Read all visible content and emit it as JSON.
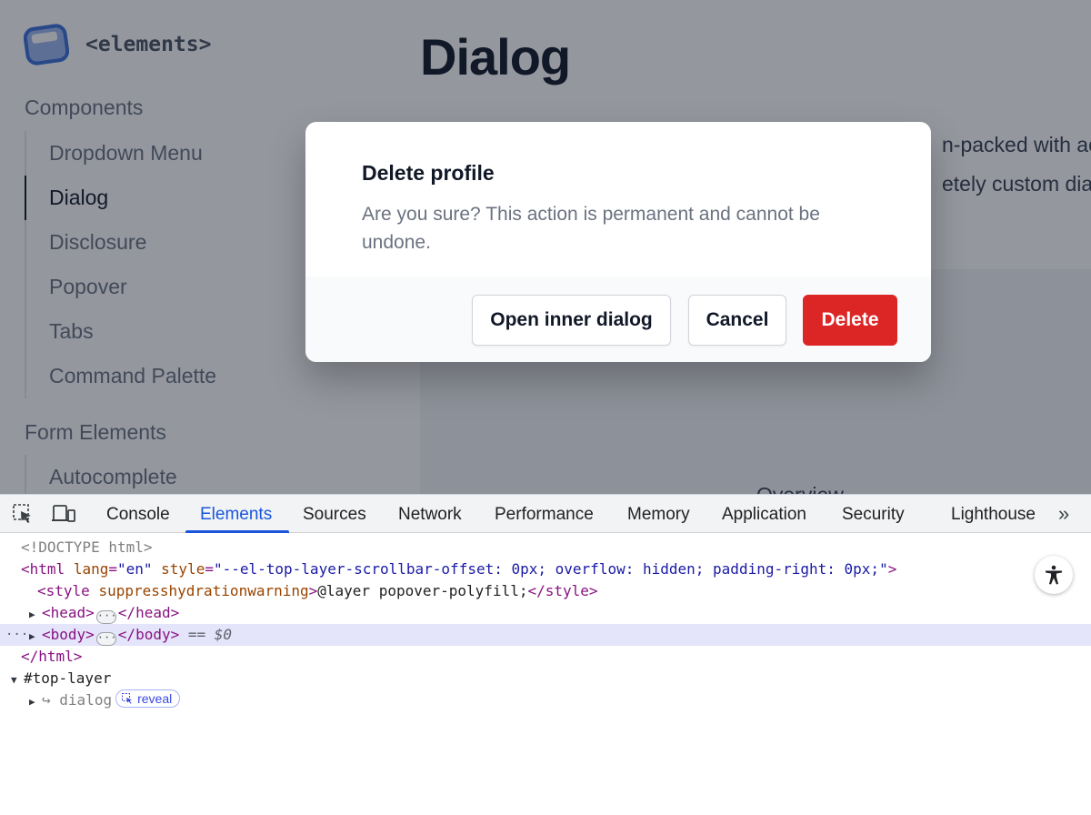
{
  "sidebar": {
    "logo_text": "<elements>",
    "sections": [
      {
        "title": "Components",
        "items": [
          "Dropdown Menu",
          "Dialog",
          "Disclosure",
          "Popover",
          "Tabs",
          "Command Palette"
        ]
      },
      {
        "title": "Form Elements",
        "items": [
          "Autocomplete"
        ]
      }
    ],
    "active_item": "Dialog"
  },
  "main": {
    "title": "Dialog",
    "intro_line1": "n-packed with ac",
    "intro_line2": "etely custom dial",
    "preview_label": "Overview"
  },
  "dialog": {
    "title": "Delete profile",
    "description": "Are you sure? This action is permanent and cannot be undone.",
    "buttons": {
      "open_inner": "Open inner dialog",
      "cancel": "Cancel",
      "delete": "Delete"
    },
    "danger_color": "#dc2626"
  },
  "devtools": {
    "tabs": [
      "Console",
      "Elements",
      "Sources",
      "Network",
      "Performance",
      "Memory",
      "Application",
      "Security",
      "Lighthouse"
    ],
    "active_tab": "Elements",
    "more_label": "»",
    "tree": {
      "doctype": "<!DOCTYPE html>",
      "html_open_tag": "<html",
      "html_attr_lang": "lang",
      "html_attr_lang_val": "\"en\"",
      "html_attr_style": "style",
      "html_attr_style_val": "\"--el-top-layer-scrollbar-offset: 0px; overflow: hidden; padding-right: 0px;\"",
      "html_open_close": ">",
      "style_open": "<style",
      "style_attr": "suppresshydrationwarning",
      "style_gt": ">",
      "style_text": "@layer popover-polyfill;",
      "style_close": "</style>",
      "head_open": "<head>",
      "head_close": "</head>",
      "body_open": "<body>",
      "body_close": "</body>",
      "body_suffix": "== $0",
      "html_close": "</html>",
      "top_layer": "#top-layer",
      "dialog_arrow": "↪",
      "dialog_node": "dialog",
      "reveal_label": "reveal",
      "ellipsis": "···"
    }
  }
}
